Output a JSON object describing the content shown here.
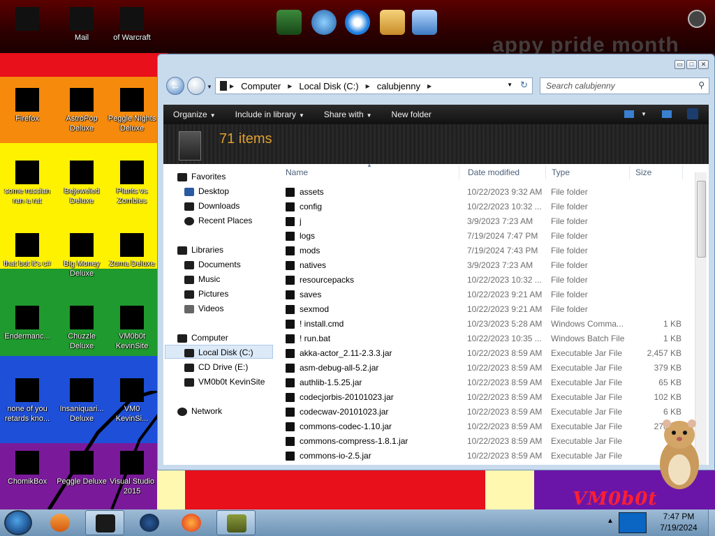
{
  "desktop": {
    "top_icons": [
      {
        "label": "",
        "name": "desktop-icon-top-1"
      },
      {
        "label": "Mail",
        "name": "desktop-icon-mail"
      },
      {
        "label": "of Warcraft",
        "name": "desktop-icon-warcraft"
      }
    ],
    "icons": [
      {
        "label": "Firefox"
      },
      {
        "label": "AstroPop\nDeluxe"
      },
      {
        "label": "Peggle Nights\nDeluxe"
      },
      {
        "label": "some russian\nran a rat"
      },
      {
        "label": "Bejeweled\nDeluxe"
      },
      {
        "label": "Plants vs\nZombies"
      },
      {
        "label": "that but it's c#"
      },
      {
        "label": "Big Money\nDeluxe"
      },
      {
        "label": "Zuma Deluxe"
      },
      {
        "label": "Endermanc..."
      },
      {
        "label": "Chuzzle\nDeluxe"
      },
      {
        "label": "VM0b0t\nKevinSite"
      },
      {
        "label": "none of you\nretards kno..."
      },
      {
        "label": "Insaniquari...\nDeluxe"
      },
      {
        "label": "VM0\nKevinSi..."
      },
      {
        "label": "ChomikBox"
      },
      {
        "label": "Peggle Deluxe"
      },
      {
        "label": "Visual Studio\n2015"
      }
    ],
    "banner_text": "appy pride month",
    "logo_text": "VM0b0t",
    "colors": {
      "red": "#e8101a",
      "orange": "#f58a0c",
      "yellow": "#fff200",
      "green": "#1f9a2e",
      "blue": "#1e4fd8",
      "purple": "#7a1a9a"
    }
  },
  "window": {
    "controls": {
      "minimize": "▭",
      "maximize": "□",
      "close": "✕"
    },
    "address": {
      "crumbs": [
        "Computer",
        "Local Disk (C:)",
        "calubjenny"
      ]
    },
    "search": {
      "placeholder": "Search calubjenny"
    },
    "toolbar": {
      "organize": "Organize",
      "include": "Include in library",
      "share": "Share with",
      "new_folder": "New folder"
    },
    "item_count": "71 items",
    "nav": {
      "favorites": "Favorites",
      "desktop": "Desktop",
      "downloads": "Downloads",
      "recent": "Recent Places",
      "libraries": "Libraries",
      "documents": "Documents",
      "music": "Music",
      "pictures": "Pictures",
      "videos": "Videos",
      "computer": "Computer",
      "local_disk": "Local Disk (C:)",
      "cd_drive": "CD Drive (E:)",
      "vm_site": "VM0b0t KevinSite",
      "network": "Network"
    },
    "columns": {
      "name": "Name",
      "date": "Date modified",
      "type": "Type",
      "size": "Size"
    },
    "files": [
      {
        "name": "assets",
        "date": "10/22/2023 9:32 AM",
        "type": "File folder",
        "size": ""
      },
      {
        "name": "config",
        "date": "10/22/2023 10:32 ...",
        "type": "File folder",
        "size": ""
      },
      {
        "name": "j",
        "date": "3/9/2023 7:23 AM",
        "type": "File folder",
        "size": ""
      },
      {
        "name": "logs",
        "date": "7/19/2024 7:47 PM",
        "type": "File folder",
        "size": ""
      },
      {
        "name": "mods",
        "date": "7/19/2024 7:43 PM",
        "type": "File folder",
        "size": ""
      },
      {
        "name": "natives",
        "date": "3/9/2023 7:23 AM",
        "type": "File folder",
        "size": ""
      },
      {
        "name": "resourcepacks",
        "date": "10/22/2023 10:32 ...",
        "type": "File folder",
        "size": ""
      },
      {
        "name": "saves",
        "date": "10/22/2023 9:21 AM",
        "type": "File folder",
        "size": ""
      },
      {
        "name": "sexmod",
        "date": "10/22/2023 9:21 AM",
        "type": "File folder",
        "size": ""
      },
      {
        "name": "! install.cmd",
        "date": "10/23/2023 5:28 AM",
        "type": "Windows Comma...",
        "size": "1 KB"
      },
      {
        "name": "! run.bat",
        "date": "10/22/2023 10:35 ...",
        "type": "Windows Batch File",
        "size": "1 KB"
      },
      {
        "name": "akka-actor_2.11-2.3.3.jar",
        "date": "10/22/2023 8:59 AM",
        "type": "Executable Jar File",
        "size": "2,457 KB"
      },
      {
        "name": "asm-debug-all-5.2.jar",
        "date": "10/22/2023 8:59 AM",
        "type": "Executable Jar File",
        "size": "379 KB"
      },
      {
        "name": "authlib-1.5.25.jar",
        "date": "10/22/2023 8:59 AM",
        "type": "Executable Jar File",
        "size": "65 KB"
      },
      {
        "name": "codecjorbis-20101023.jar",
        "date": "10/22/2023 8:59 AM",
        "type": "Executable Jar File",
        "size": "102 KB"
      },
      {
        "name": "codecwav-20101023.jar",
        "date": "10/22/2023 8:59 AM",
        "type": "Executable Jar File",
        "size": "6 KB"
      },
      {
        "name": "commons-codec-1.10.jar",
        "date": "10/22/2023 8:59 AM",
        "type": "Executable Jar File",
        "size": "278 KB"
      },
      {
        "name": "commons-compress-1.8.1.jar",
        "date": "10/22/2023 8:59 AM",
        "type": "Executable Jar File",
        "size": ""
      },
      {
        "name": "commons-io-2.5.jar",
        "date": "10/22/2023 8:59 AM",
        "type": "Executable Jar File",
        "size": "2..."
      }
    ]
  },
  "taskbar": {
    "time": "7:47 PM",
    "date": "7/19/2024"
  }
}
